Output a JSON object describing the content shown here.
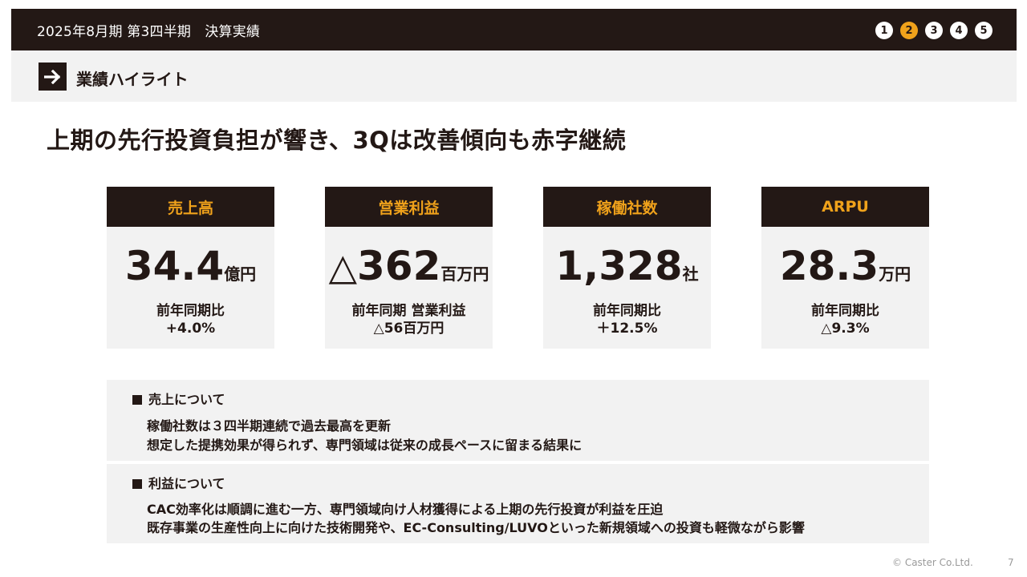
{
  "header": {
    "title": "2025年8月期 第3四半期　決算実績",
    "steps": [
      "1",
      "2",
      "3",
      "4",
      "5"
    ],
    "active_step": "2"
  },
  "section": {
    "label": "業績ハイライト"
  },
  "headline": "上期の先行投資負担が響き、3Qは改善傾向も赤字継続",
  "kpis": [
    {
      "title": "売上高",
      "prefix": "",
      "value": "34.4",
      "unit": "億円",
      "sub1": "前年同期比",
      "sub2": "+4.0%"
    },
    {
      "title": "営業利益",
      "prefix": "△",
      "value": "362",
      "unit": "百万円",
      "sub1": "前年同期 営業利益",
      "sub2": "△56百万円"
    },
    {
      "title": "稼働社数",
      "prefix": "",
      "value": "1,328",
      "unit": "社",
      "sub1": "前年同期比",
      "sub2": "＋12.5%"
    },
    {
      "title": "ARPU",
      "prefix": "",
      "value": "28.3",
      "unit": "万円",
      "sub1": "前年同期比",
      "sub2": "△9.3%"
    }
  ],
  "notes": [
    {
      "heading": "売上について",
      "lines": [
        "稼働社数は３四半期連続で過去最高を更新",
        "想定した提携効果が得られず、専門領域は従来の成長ペースに留まる結果に"
      ]
    },
    {
      "heading": "利益について",
      "lines": [
        "CAC効率化は順調に進む一方、専門領域向け人材獲得による上期の先行投資が利益を圧迫",
        "既存事業の生産性向上に向けた技術開発や、EC-Consulting/LUVOといった新規領域への投資も軽微ながら影響"
      ]
    }
  ],
  "footer": {
    "copyright": "© Caster Co.Ltd.",
    "page": "7"
  },
  "colors": {
    "dark": "#231815",
    "accent": "#f0a21b",
    "panel": "#f2f2f2"
  }
}
